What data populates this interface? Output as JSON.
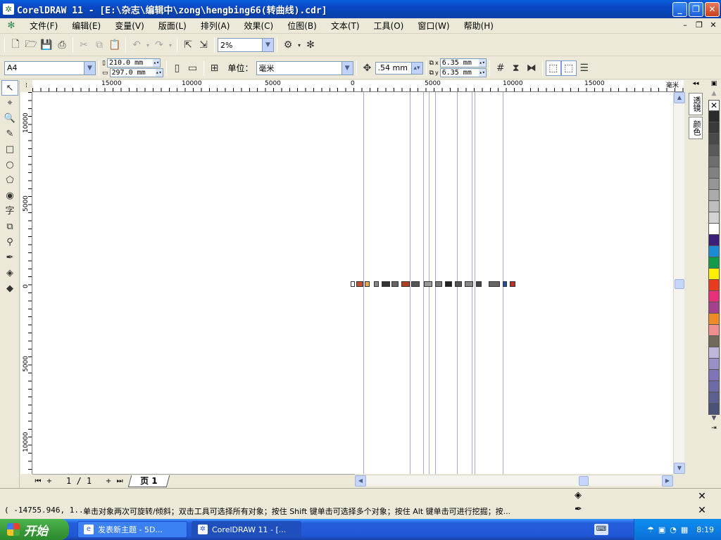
{
  "window": {
    "title": "CorelDRAW 11 - [E:\\杂志\\编辑中\\zong\\hengbing66(转曲线).cdr]",
    "app_icon": "corel-balloon-icon"
  },
  "menu": {
    "items": [
      "文件(F)",
      "编辑(E)",
      "变量(V)",
      "版面(L)",
      "排列(A)",
      "效果(C)",
      "位图(B)",
      "文本(T)",
      "工具(O)",
      "窗口(W)",
      "帮助(H)"
    ]
  },
  "standard_toolbar": {
    "zoom": "2%"
  },
  "property_bar": {
    "paper_size": "A4",
    "width": "210.0 mm",
    "height": "297.0 mm",
    "units_label": "单位：",
    "units": "毫米",
    "nudge": ".54 mm",
    "dup_x": "6.35 mm",
    "dup_y": "6.35 mm",
    "x_label": "x",
    "y_label": "y"
  },
  "ruler": {
    "top_labels": [
      "15000",
      "10000",
      "5000",
      "0",
      "5000",
      "10000",
      "15000"
    ],
    "top_unit": "毫米",
    "left_labels": [
      "10000",
      "5000",
      "0",
      "5000",
      "10000"
    ],
    "left_unit": "毫米"
  },
  "page_nav": {
    "count": "1 / 1",
    "tab": "页 1"
  },
  "dockers": [
    "透镜",
    "颜色"
  ],
  "palette": {
    "colors": [
      "#2b2b2b",
      "#3a3a3a",
      "#4a4a4a",
      "#5a5a5a",
      "#6e6e6e",
      "#828282",
      "#969696",
      "#aaaaaa",
      "#bebebe",
      "#d2d2d2",
      "#ffffff",
      "#3d1e78",
      "#1c8bd6",
      "#109a4a",
      "#ffef00",
      "#ea3b1e",
      "#e8307a",
      "#a4408e",
      "#f08a24",
      "#ef8f90",
      "#6f6a5a",
      "#c0b8da",
      "#9a90c8",
      "#7f74b8",
      "#6d6aa8",
      "#5b6090",
      "#4a5278"
    ]
  },
  "status": {
    "coords": "( -14755.946, 1...",
    "hint": "单击对象两次可旋转/倾斜；双击工具可选择所有对象；按住 Shift 键单击可选择多个对象；按住 Alt 键单击可进行挖掘；按..."
  },
  "taskbar": {
    "start": "开始",
    "tasks": [
      {
        "label": "发表新主题 - 5D...",
        "active": false
      },
      {
        "label": "CorelDRAW 11 - [...",
        "active": true
      }
    ],
    "clock": "8:19"
  }
}
